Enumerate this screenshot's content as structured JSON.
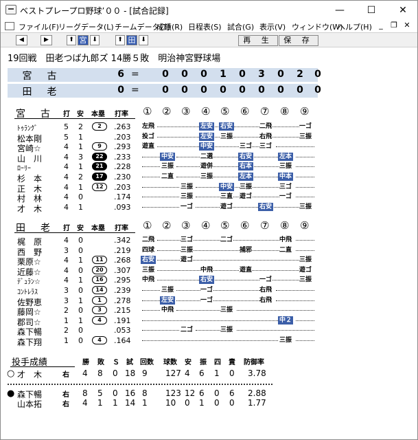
{
  "window": {
    "title": "ベストプレープロ野球’００ - [試合記録]",
    "minimize": "—",
    "maximize": "☐",
    "close": "✕"
  },
  "menu": [
    "ファイル(F)",
    "リーグデータ(L)",
    "チームデータ(T)",
    "成績(R)",
    "日程表(S)",
    "試合(G)",
    "表示(V)",
    "ウィンドウ(W)",
    "ヘルプ(H)"
  ],
  "mdi": {
    "min": "_",
    "restore": "❐",
    "close": "✕"
  },
  "toolbar": {
    "left": "◀",
    "right": "▶",
    "up1": "⬆",
    "team1": "宮",
    "down1": "⬇",
    "up2": "⬆",
    "team2": "田",
    "down2": "⬇",
    "replay": "再 生",
    "save": "保 存"
  },
  "match": {
    "info": "19回戦　田老つば九郎ズ 14勝５敗　明治神宮野球場"
  },
  "score": {
    "rows": [
      {
        "name": "宮古",
        "total": "6",
        "eq": "=",
        "innings": [
          "0",
          "0",
          "0",
          "1",
          "0",
          "3",
          "0",
          "2",
          "0"
        ]
      },
      {
        "name": "田老",
        "total": "0",
        "eq": "=",
        "innings": [
          "0",
          "0",
          "0",
          "0",
          "0",
          "0",
          "0",
          "0",
          "0"
        ]
      }
    ]
  },
  "columns": {
    "at_bat": "打",
    "hit": "安",
    "hr": "本塁",
    "avg": "打率",
    "innings": [
      "①",
      "②",
      "③",
      "④",
      "⑤",
      "⑥",
      "⑦",
      "⑧",
      "⑨"
    ]
  },
  "team1": {
    "name": "宮古",
    "players": [
      {
        "name": "ﾄｩﾗﾝｸﾞ",
        "ab": "5",
        "h": "2",
        "hr": "2",
        "hrfill": false,
        "avg": ".263"
      },
      {
        "name": "松本剛",
        "ab": "5",
        "h": "1",
        "hr": "",
        "hrfill": false,
        "avg": ".203"
      },
      {
        "name": "宮崎☆",
        "ab": "4",
        "h": "1",
        "hr": "9",
        "hrfill": false,
        "avg": ".293"
      },
      {
        "name": "山　川",
        "ab": "4",
        "h": "3",
        "hr": "22",
        "hrfill": true,
        "avg": ".233"
      },
      {
        "name": "ﾛｰﾘｰ",
        "ab": "4",
        "h": "1",
        "hr": "21",
        "hrfill": true,
        "avg": ".228"
      },
      {
        "name": "杉　本",
        "ab": "4",
        "h": "2",
        "hr": "17",
        "hrfill": true,
        "avg": ".230"
      },
      {
        "name": "正　木",
        "ab": "4",
        "h": "1",
        "hr": "12",
        "hrfill": false,
        "avg": ".203"
      },
      {
        "name": "村　林",
        "ab": "4",
        "h": "0",
        "hr": "",
        "hrfill": false,
        "avg": ".174"
      },
      {
        "name": "才　木",
        "ab": "4",
        "h": "1",
        "hr": "",
        "hrfill": false,
        "avg": ".093"
      }
    ]
  },
  "team2": {
    "name": "田老",
    "players": [
      {
        "name": "梶　原",
        "ab": "4",
        "h": "0",
        "hr": "",
        "hrfill": false,
        "avg": ".342"
      },
      {
        "name": "西　野",
        "ab": "3",
        "h": "0",
        "hr": "",
        "hrfill": false,
        "avg": ".219"
      },
      {
        "name": "栗原☆",
        "ab": "4",
        "h": "1",
        "hr": "11",
        "hrfill": false,
        "avg": ".268"
      },
      {
        "name": "近藤☆",
        "ab": "4",
        "h": "0",
        "hr": "20",
        "hrfill": false,
        "avg": ".307"
      },
      {
        "name": "ﾃﾞｭﾗﾝ☆",
        "ab": "4",
        "h": "1",
        "hr": "16",
        "hrfill": false,
        "avg": ".295"
      },
      {
        "name": "ｺﾝﾄﾚﾗｽ",
        "ab": "3",
        "h": "0",
        "hr": "14",
        "hrfill": false,
        "avg": ".239"
      },
      {
        "name": "佐野恵",
        "ab": "3",
        "h": "1",
        "hr": "1",
        "hrfill": false,
        "avg": ".278"
      },
      {
        "name": "藤岡☆",
        "ab": "2",
        "h": "0",
        "hr": "3",
        "hrfill": false,
        "avg": ".215"
      },
      {
        "name": "郡司☆",
        "ab": "1",
        "h": "1",
        "hr": "4",
        "hrfill": false,
        "avg": ".191"
      },
      {
        "name": "森下暢",
        "ab": "2",
        "h": "0",
        "hr": "",
        "hrfill": false,
        "avg": ".053"
      },
      {
        "name": "森下翔",
        "ab": "1",
        "h": "0",
        "hr": "4",
        "hrfill": false,
        "avg": ".164"
      }
    ]
  },
  "results1": [
    [
      {
        "t": "左飛",
        "i": 1,
        "hl": false
      },
      {
        "t": "左安",
        "i": 4,
        "hl": true
      },
      {
        "t": "右安",
        "i": 5,
        "hl": true
      },
      {
        "t": "二飛",
        "i": 7,
        "hl": false
      },
      {
        "t": "一ゴ",
        "i": 9,
        "hl": false
      }
    ],
    [
      {
        "t": "投ゴ",
        "i": 1,
        "hl": false
      },
      {
        "t": "左安",
        "i": 4,
        "hl": true
      },
      {
        "t": "三振",
        "i": 5,
        "hl": false
      },
      {
        "t": "右飛",
        "i": 7,
        "hl": false
      },
      {
        "t": "三振",
        "i": 9,
        "hl": false
      }
    ],
    [
      {
        "t": "遊直",
        "i": 1,
        "hl": false
      },
      {
        "t": "中安",
        "i": 4,
        "hl": true
      },
      {
        "t": "三ゴ",
        "i": 6,
        "hl": false
      },
      {
        "t": "三ゴ",
        "i": 7,
        "hl": false
      }
    ],
    [
      {
        "t": "中安",
        "i": 2,
        "hl": true
      },
      {
        "t": "二選",
        "i": 4,
        "hl": false
      },
      {
        "t": "右安",
        "i": 6,
        "hl": true
      },
      {
        "t": "左本",
        "i": 8,
        "hl": true
      }
    ],
    [
      {
        "t": "三振",
        "i": 2,
        "hl": false
      },
      {
        "t": "遊併",
        "i": 4,
        "hl": false
      },
      {
        "t": "右本",
        "i": 6,
        "hl": true
      },
      {
        "t": "三振",
        "i": 8,
        "hl": false
      }
    ],
    [
      {
        "t": "二直",
        "i": 2,
        "hl": false
      },
      {
        "t": "三振",
        "i": 4,
        "hl": false
      },
      {
        "t": "左本",
        "i": 6,
        "hl": true
      },
      {
        "t": "中本",
        "i": 8,
        "hl": true
      }
    ],
    [
      {
        "t": "三振",
        "i": 3,
        "hl": false
      },
      {
        "t": "中安",
        "i": 5,
        "hl": true
      },
      {
        "t": "三振",
        "i": 6,
        "hl": false
      },
      {
        "t": "三ゴ",
        "i": 8,
        "hl": false
      }
    ],
    [
      {
        "t": "三振",
        "i": 3,
        "hl": false
      },
      {
        "t": "三直",
        "i": 5,
        "hl": false
      },
      {
        "t": "遊ゴ",
        "i": 6,
        "hl": false
      },
      {
        "t": "一ゴ",
        "i": 8,
        "hl": false
      }
    ],
    [
      {
        "t": "一ゴ",
        "i": 3,
        "hl": false
      },
      {
        "t": "遊ゴ",
        "i": 5,
        "hl": false
      },
      {
        "t": "右安",
        "i": 7,
        "hl": true
      },
      {
        "t": "三振",
        "i": 9,
        "hl": false
      }
    ]
  ],
  "results2": [
    [
      {
        "t": "二飛",
        "i": 1,
        "hl": false
      },
      {
        "t": "三ゴ",
        "i": 3,
        "hl": false
      },
      {
        "t": "二ゴ",
        "i": 5,
        "hl": false
      },
      {
        "t": "中飛",
        "i": 8,
        "hl": false
      }
    ],
    [
      {
        "t": "四球",
        "i": 1,
        "hl": false
      },
      {
        "t": "三振",
        "i": 3,
        "hl": false
      },
      {
        "t": "捕邪",
        "i": 6,
        "hl": false
      },
      {
        "t": "二直",
        "i": 8,
        "hl": false
      }
    ],
    [
      {
        "t": "右安",
        "i": 1,
        "hl": true
      },
      {
        "t": "遊ゴ",
        "i": 3,
        "hl": false
      },
      {
        "t": "三振",
        "i": 9,
        "hl": false
      }
    ],
    [
      {
        "t": "三振",
        "i": 1,
        "hl": false
      },
      {
        "t": "中飛",
        "i": 4,
        "hl": false
      },
      {
        "t": "遊直",
        "i": 6,
        "hl": false
      },
      {
        "t": "遊ゴ",
        "i": 9,
        "hl": false
      }
    ],
    [
      {
        "t": "中飛",
        "i": 1,
        "hl": false
      },
      {
        "t": "右安",
        "i": 4,
        "hl": true
      },
      {
        "t": "一ゴ",
        "i": 7,
        "hl": false
      },
      {
        "t": "三振",
        "i": 9,
        "hl": false
      }
    ],
    [
      {
        "t": "三振",
        "i": 2,
        "hl": false
      },
      {
        "t": "一ゴ",
        "i": 4,
        "hl": false
      },
      {
        "t": "右飛",
        "i": 7,
        "hl": false
      }
    ],
    [
      {
        "t": "左安",
        "i": 2,
        "hl": true
      },
      {
        "t": "一ゴ",
        "i": 4,
        "hl": false
      },
      {
        "t": "右飛",
        "i": 7,
        "hl": false
      }
    ],
    [
      {
        "t": "中飛",
        "i": 2,
        "hl": false
      },
      {
        "t": "三振",
        "i": 5,
        "hl": false
      }
    ],
    [
      {
        "t": "中２",
        "i": 8,
        "hl": true
      }
    ],
    [
      {
        "t": "二ゴ",
        "i": 3,
        "hl": false
      },
      {
        "t": "三振",
        "i": 5,
        "hl": false
      }
    ],
    [
      {
        "t": "三振",
        "i": 8,
        "hl": false
      }
    ]
  ],
  "pitching": {
    "header": "投手成績",
    "cols": [
      "勝",
      "敗",
      "Ｓ",
      "試",
      "回数",
      "球数",
      "安",
      "振",
      "四",
      "責",
      "防御率"
    ],
    "team1": [
      {
        "mark": "○",
        "name": "才　木",
        "hand": "右",
        "w": "4",
        "l": "8",
        "s": "0",
        "g": "18",
        "ip": "9",
        "pc": "127",
        "h": "4",
        "so": "6",
        "bb": "1",
        "er": "0",
        "era": "3.78"
      }
    ],
    "team2": [
      {
        "mark": "●",
        "name": "森下暢",
        "hand": "右",
        "w": "8",
        "l": "5",
        "s": "0",
        "g": "16",
        "ip": "8",
        "pc": "123",
        "h": "12",
        "so": "6",
        "bb": "0",
        "er": "6",
        "era": "2.88"
      },
      {
        "mark": "",
        "name": "山本拓",
        "hand": "右",
        "w": "4",
        "l": "1",
        "s": "1",
        "g": "14",
        "ip": "1",
        "pc": "10",
        "h": "0",
        "so": "1",
        "bb": "0",
        "er": "0",
        "era": "1.77"
      }
    ]
  }
}
